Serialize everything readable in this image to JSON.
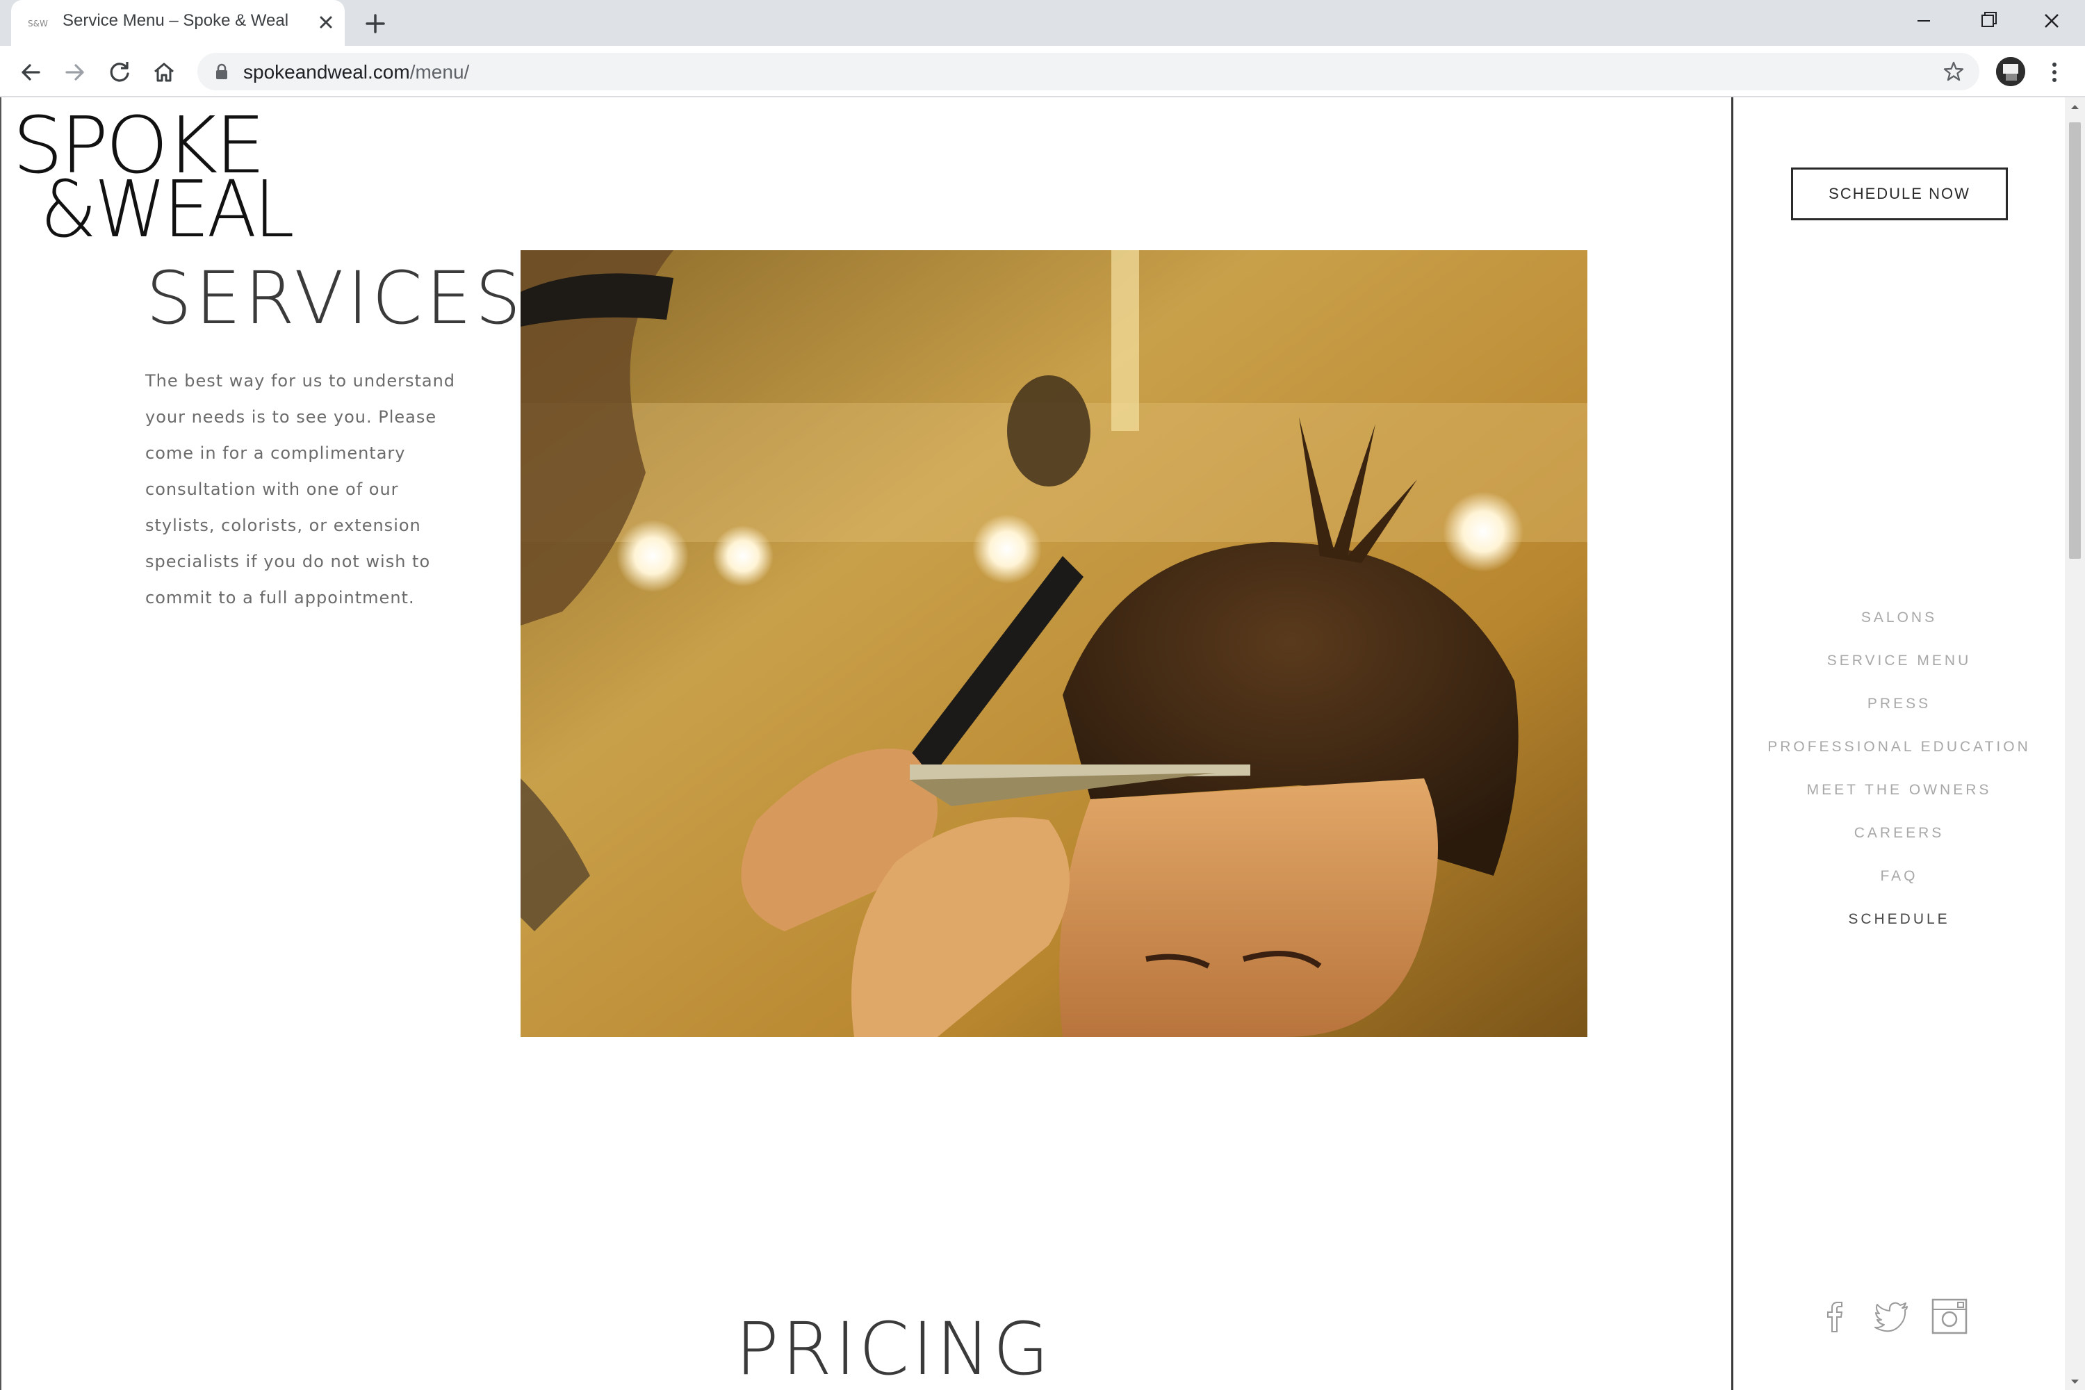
{
  "browser": {
    "tab_title": "Service Menu – Spoke & Weal",
    "url_domain": "spokeandweal.com",
    "url_path": "/menu/"
  },
  "page": {
    "logo_text": "SPOKE &WEAL",
    "services_title": "SERVICES",
    "intro_text": "The best way for us to understand your needs is to see you. Please come in for a complimentary consultation with one of our stylists, colorists, or extension specialists if you do not wish to commit to a full appointment.",
    "pricing_title": "PRICING"
  },
  "right_panel": {
    "schedule_button": "SCHEDULE NOW",
    "nav_items": [
      {
        "label": "SALONS"
      },
      {
        "label": "SERVICE MENU"
      },
      {
        "label": "PRESS"
      },
      {
        "label": "PROFESSIONAL EDUCATION"
      },
      {
        "label": "MEET THE OWNERS"
      },
      {
        "label": "CAREERS"
      },
      {
        "label": "FAQ"
      },
      {
        "label": "SCHEDULE"
      }
    ],
    "social": [
      "facebook-icon",
      "twitter-icon",
      "instagram-icon"
    ]
  }
}
